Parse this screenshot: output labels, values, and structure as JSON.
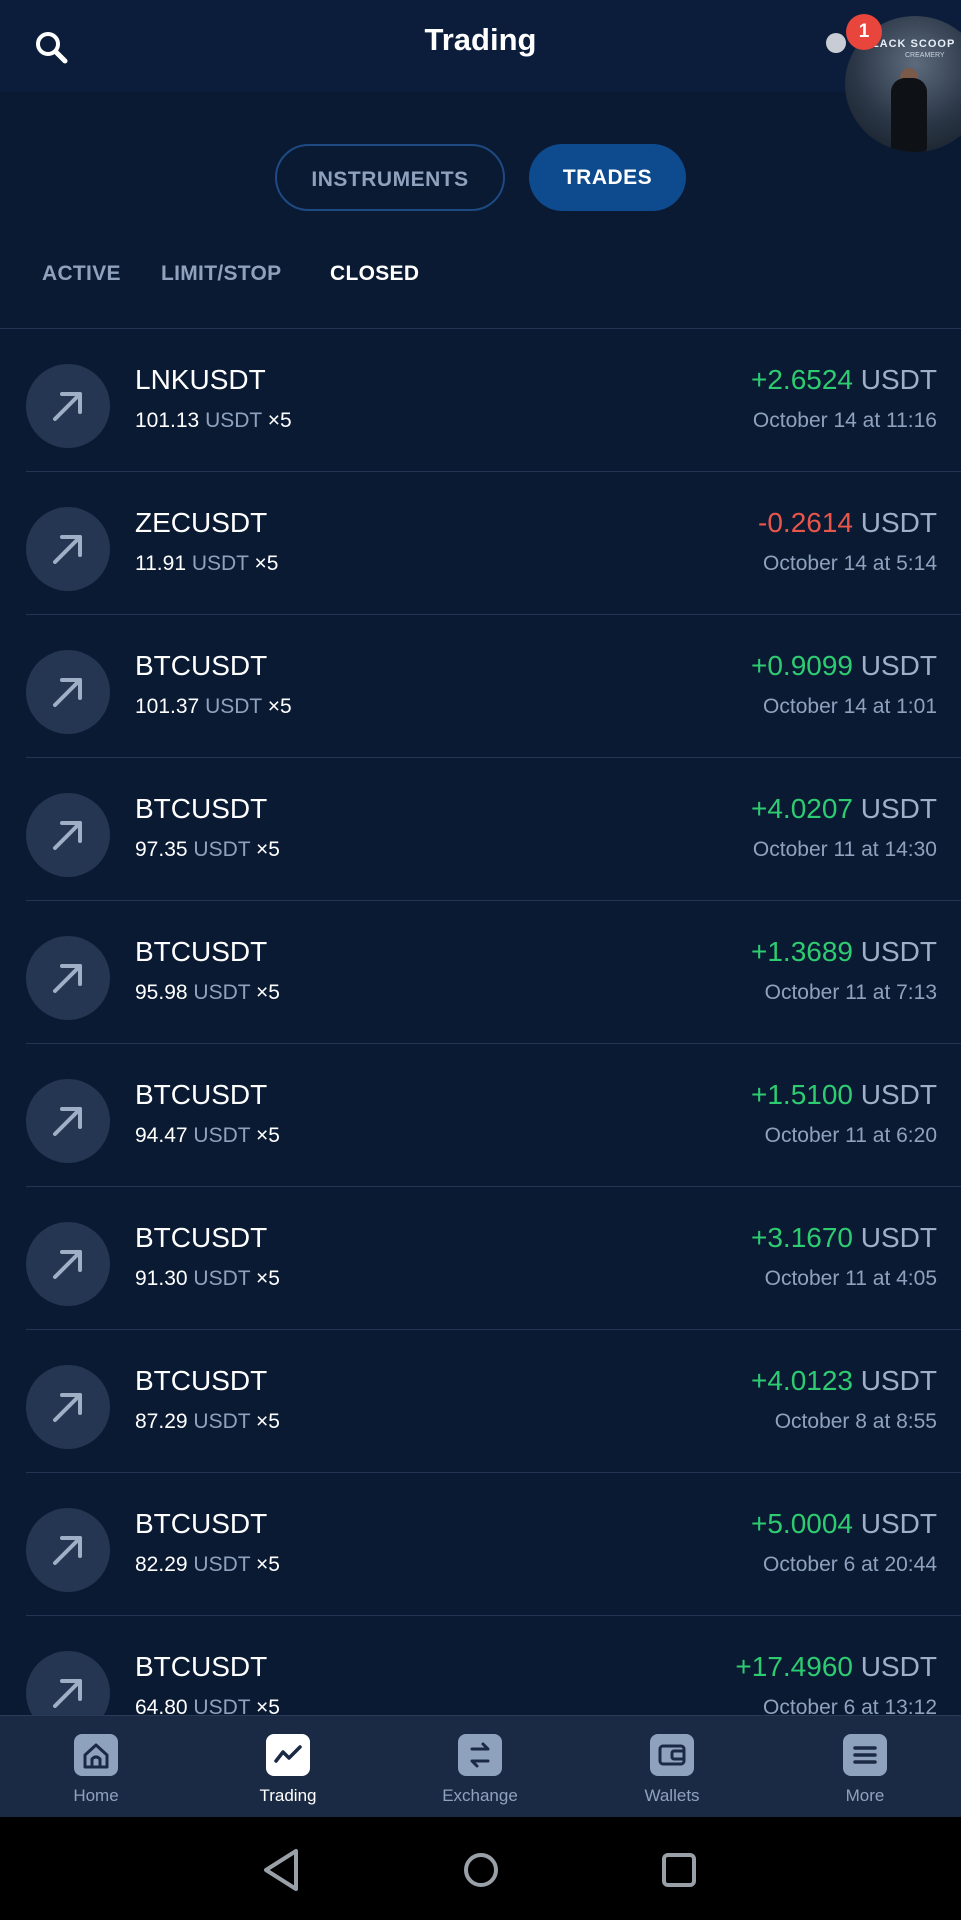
{
  "header": {
    "title": "Trading",
    "notification_count": "1"
  },
  "segments": {
    "instruments": "INSTRUMENTS",
    "trades": "TRADES"
  },
  "subtabs": {
    "active": "ACTIVE",
    "limit_stop": "LIMIT/STOP",
    "closed": "CLOSED"
  },
  "trades": [
    {
      "symbol": "LNKUSDT",
      "amount": "101.13",
      "unit": "USDT",
      "leverage": "×5",
      "pnl": "+2.6524",
      "pnl_sign": "positive",
      "pnl_currency": "USDT",
      "time": "October 14 at 11:16"
    },
    {
      "symbol": "ZECUSDT",
      "amount": "11.91",
      "unit": "USDT",
      "leverage": "×5",
      "pnl": "-0.2614",
      "pnl_sign": "negative",
      "pnl_currency": "USDT",
      "time": "October 14 at 5:14"
    },
    {
      "symbol": "BTCUSDT",
      "amount": "101.37",
      "unit": "USDT",
      "leverage": "×5",
      "pnl": "+0.9099",
      "pnl_sign": "positive",
      "pnl_currency": "USDT",
      "time": "October 14 at 1:01"
    },
    {
      "symbol": "BTCUSDT",
      "amount": "97.35",
      "unit": "USDT",
      "leverage": "×5",
      "pnl": "+4.0207",
      "pnl_sign": "positive",
      "pnl_currency": "USDT",
      "time": "October 11 at 14:30"
    },
    {
      "symbol": "BTCUSDT",
      "amount": "95.98",
      "unit": "USDT",
      "leverage": "×5",
      "pnl": "+1.3689",
      "pnl_sign": "positive",
      "pnl_currency": "USDT",
      "time": "October 11 at 7:13"
    },
    {
      "symbol": "BTCUSDT",
      "amount": "94.47",
      "unit": "USDT",
      "leverage": "×5",
      "pnl": "+1.5100",
      "pnl_sign": "positive",
      "pnl_currency": "USDT",
      "time": "October 11 at 6:20"
    },
    {
      "symbol": "BTCUSDT",
      "amount": "91.30",
      "unit": "USDT",
      "leverage": "×5",
      "pnl": "+3.1670",
      "pnl_sign": "positive",
      "pnl_currency": "USDT",
      "time": "October 11 at 4:05"
    },
    {
      "symbol": "BTCUSDT",
      "amount": "87.29",
      "unit": "USDT",
      "leverage": "×5",
      "pnl": "+4.0123",
      "pnl_sign": "positive",
      "pnl_currency": "USDT",
      "time": "October 8 at 8:55"
    },
    {
      "symbol": "BTCUSDT",
      "amount": "82.29",
      "unit": "USDT",
      "leverage": "×5",
      "pnl": "+5.0004",
      "pnl_sign": "positive",
      "pnl_currency": "USDT",
      "time": "October 6 at 20:44"
    },
    {
      "symbol": "BTCUSDT",
      "amount": "64.80",
      "unit": "USDT",
      "leverage": "×5",
      "pnl": "+17.4960",
      "pnl_sign": "positive",
      "pnl_currency": "USDT",
      "time": "October 6 at 13:12"
    }
  ],
  "bottom_nav": [
    {
      "label": "Home",
      "icon": "home-icon",
      "active": false
    },
    {
      "label": "Trading",
      "icon": "trading-chart-icon",
      "active": true
    },
    {
      "label": "Exchange",
      "icon": "exchange-icon",
      "active": false
    },
    {
      "label": "Wallets",
      "icon": "wallet-icon",
      "active": false
    },
    {
      "label": "More",
      "icon": "menu-icon",
      "active": false
    }
  ],
  "avatar_sign": "BLACK SCOOP",
  "avatar_sign_sub": "CREAMERY",
  "colors": {
    "background": "#0b1a33",
    "positive": "#2ecc71",
    "negative": "#e8564a",
    "accent": "#0e4a8e",
    "muted": "#8ea2bd"
  }
}
